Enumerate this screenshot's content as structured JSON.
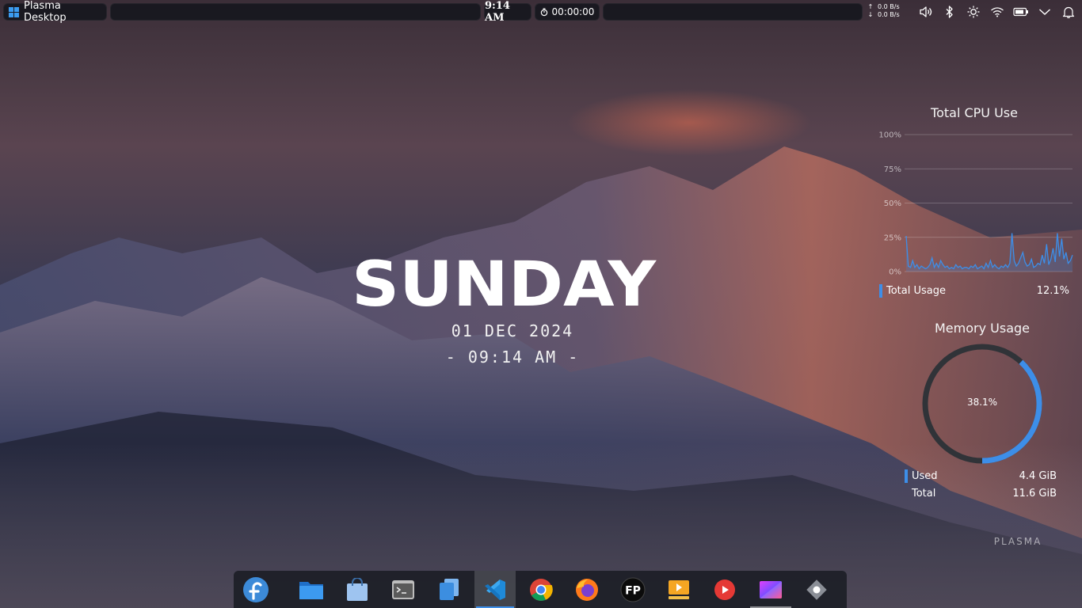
{
  "panel": {
    "launcher_label": "Plasma Desktop",
    "clock": "9:14 AM",
    "timer": "00:00:00",
    "net_up": "0.0 B/s",
    "net_down": "0.0 B/s",
    "tray_icons": [
      "volume-icon",
      "bluetooth-icon",
      "brightness-icon",
      "wifi-icon",
      "battery-icon",
      "expand-tray-icon",
      "notifications-icon"
    ]
  },
  "desktop": {
    "day": "SUNDAY",
    "date": "01 DEC 2024",
    "time": "- 09:14 AM -",
    "watermark": "PLASMA"
  },
  "cpu_widget": {
    "title": "Total CPU Use",
    "ticks": [
      "100%",
      "75%",
      "50%",
      "25%",
      "0%"
    ],
    "legend_label": "Total Usage",
    "legend_value": "12.1%",
    "series_color": "#3d8ee8"
  },
  "memory_widget": {
    "title": "Memory Usage",
    "percent_label": "38.1%",
    "used_fraction": 0.381,
    "used_label": "Used",
    "used_value": "4.4 GiB",
    "total_label": "Total",
    "total_value": "11.6 GiB",
    "ring_color": "#3d8ee8"
  },
  "chart_data": {
    "type": "line",
    "title": "Total CPU Use",
    "xlabel": "",
    "ylabel": "",
    "ylim": [
      0,
      100
    ],
    "y_ticks": [
      "100%",
      "75%",
      "50%",
      "25%",
      "0%"
    ],
    "grid": true,
    "series": [
      {
        "name": "Total Usage",
        "values": [
          26,
          4,
          3,
          8,
          3,
          5,
          2,
          4,
          3,
          2,
          3,
          5,
          10,
          3,
          6,
          3,
          8,
          5,
          3,
          4,
          2,
          3,
          2,
          5,
          3,
          4,
          2,
          3,
          3,
          2,
          4,
          3,
          5,
          2,
          3,
          4,
          2,
          6,
          3,
          8,
          3,
          5,
          3,
          2,
          4,
          3,
          5,
          3,
          6,
          28,
          8,
          4,
          6,
          10,
          14,
          7,
          4,
          5,
          9,
          3,
          4,
          6,
          5,
          12,
          6,
          20,
          5,
          9,
          17,
          7,
          28,
          11,
          24,
          9,
          14,
          6,
          8,
          12
        ]
      }
    ]
  },
  "dock": {
    "items": [
      {
        "name": "fedora-icon"
      },
      {
        "name": "files-icon"
      },
      {
        "name": "software-store-icon"
      },
      {
        "name": "terminal-icon"
      },
      {
        "name": "documents-icon"
      },
      {
        "name": "vscode-icon"
      },
      {
        "name": "chrome-icon"
      },
      {
        "name": "firefox-icon"
      },
      {
        "name": "fp-app-icon",
        "text": "FP"
      },
      {
        "name": "media-player-icon"
      },
      {
        "name": "youtube-icon"
      },
      {
        "name": "gradient-app-icon"
      },
      {
        "name": "settings-icon"
      }
    ]
  }
}
